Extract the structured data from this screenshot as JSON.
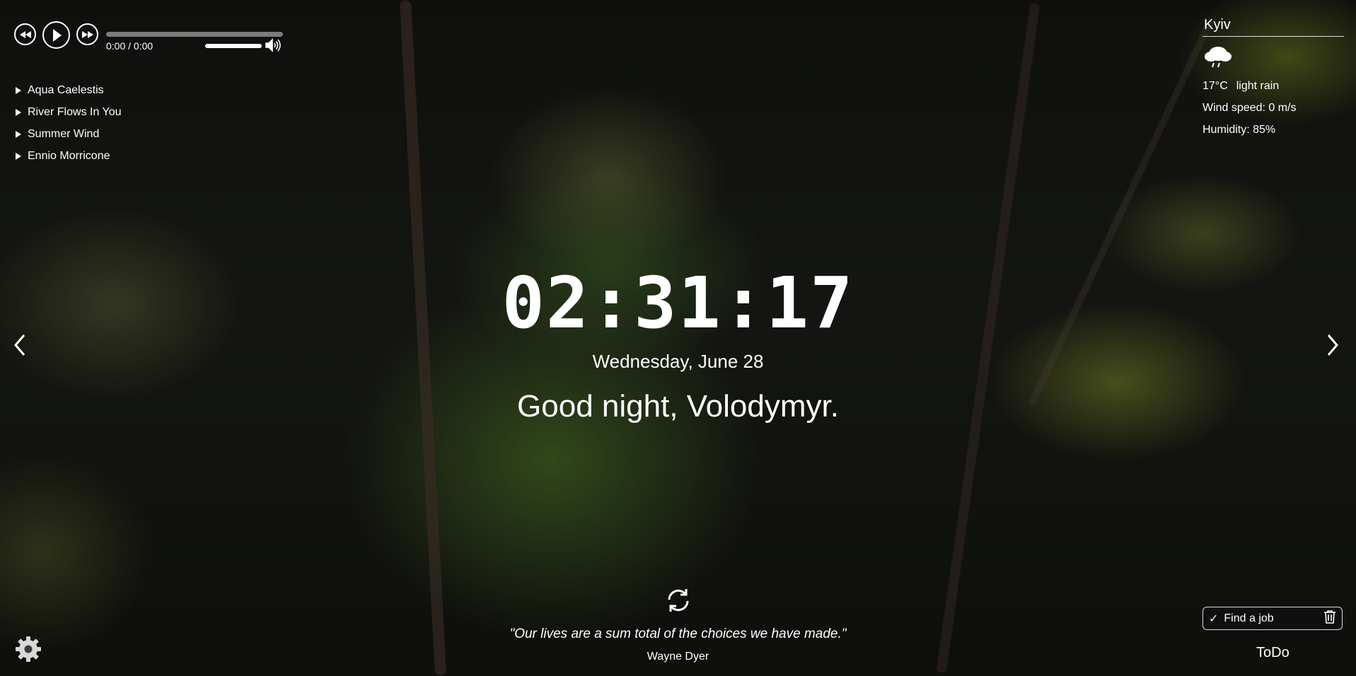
{
  "player": {
    "time": "0:00 / 0:00",
    "progress": 0,
    "volume": 1.0,
    "buttons": [
      "rewind-icon",
      "play-icon",
      "fast-forward-icon"
    ],
    "playlist": [
      {
        "title": "Aqua Caelestis"
      },
      {
        "title": "River Flows In You"
      },
      {
        "title": "Summer Wind"
      },
      {
        "title": "Ennio Morricone"
      }
    ]
  },
  "weather": {
    "city": "Kyiv",
    "icon": "rain-cloud-icon",
    "temperature": "17°C",
    "description": "light rain",
    "wind": "Wind speed: 0 m/s",
    "humidity": "Humidity: 85%"
  },
  "clock": {
    "time": "02:31:17",
    "date": "Wednesday, June 28",
    "greeting": "Good night, Volodymyr."
  },
  "quote": {
    "text": "\"Our lives are a sum total of the choices we have made.\"",
    "author": "Wayne Dyer"
  },
  "todo": {
    "title": "ToDo",
    "items": [
      {
        "text": "Find a job",
        "done": true
      }
    ]
  }
}
